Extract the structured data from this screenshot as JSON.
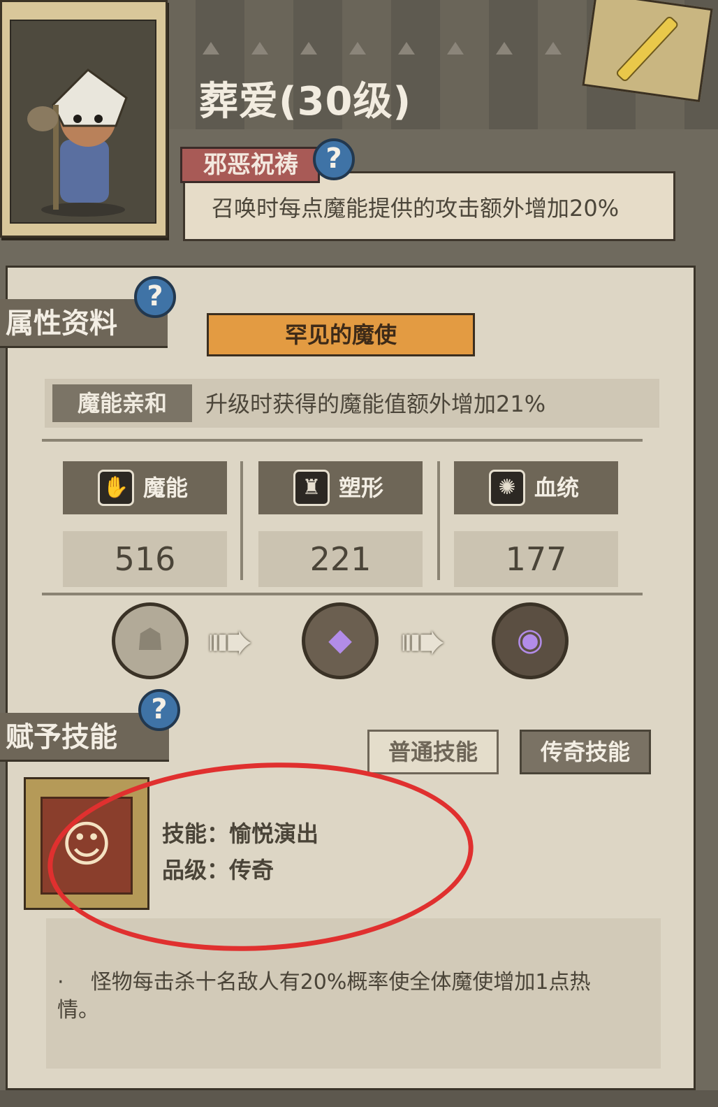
{
  "unit": {
    "name_level": "葬爱(30级)"
  },
  "trait": {
    "label": "邪恶祝祷",
    "description": "召唤时每点魔能提供的攻击额外增加20%",
    "help_icon": "?"
  },
  "attributes": {
    "section_title": "属性资料",
    "rarity": "罕见的魔使",
    "affinity_label": "魔能亲和",
    "affinity_description": "升级时获得的魔能值额外增加21%",
    "stats": [
      {
        "label": "魔能",
        "value": "516",
        "icon": "magic-claw-icon"
      },
      {
        "label": "塑形",
        "value": "221",
        "icon": "muscle-body-icon"
      },
      {
        "label": "血统",
        "value": "177",
        "icon": "blood-splat-icon"
      }
    ],
    "evolution": [
      {
        "icon": "hooded-figure-icon",
        "state": "locked"
      },
      {
        "icon": "purple-crystal-sword-icon",
        "state": "active"
      },
      {
        "icon": "purple-eye-icon",
        "state": "active"
      }
    ]
  },
  "skills": {
    "section_title": "赋予技能",
    "tabs": [
      {
        "label": "普通技能",
        "selected": false
      },
      {
        "label": "传奇技能",
        "selected": true
      }
    ],
    "skill_name_line": "技能：愉悦演出",
    "grade_line": "品级：传奇",
    "description_bullet": "·",
    "description": "怪物每击杀十名敌人有20%概率使全体魔使增加1点热情。"
  },
  "colors": {
    "annotation_circle": "#e0302f",
    "rarity_banner": "#e39b42",
    "trait_tag": "#a85a56",
    "help_badge": "#3f73a6"
  }
}
